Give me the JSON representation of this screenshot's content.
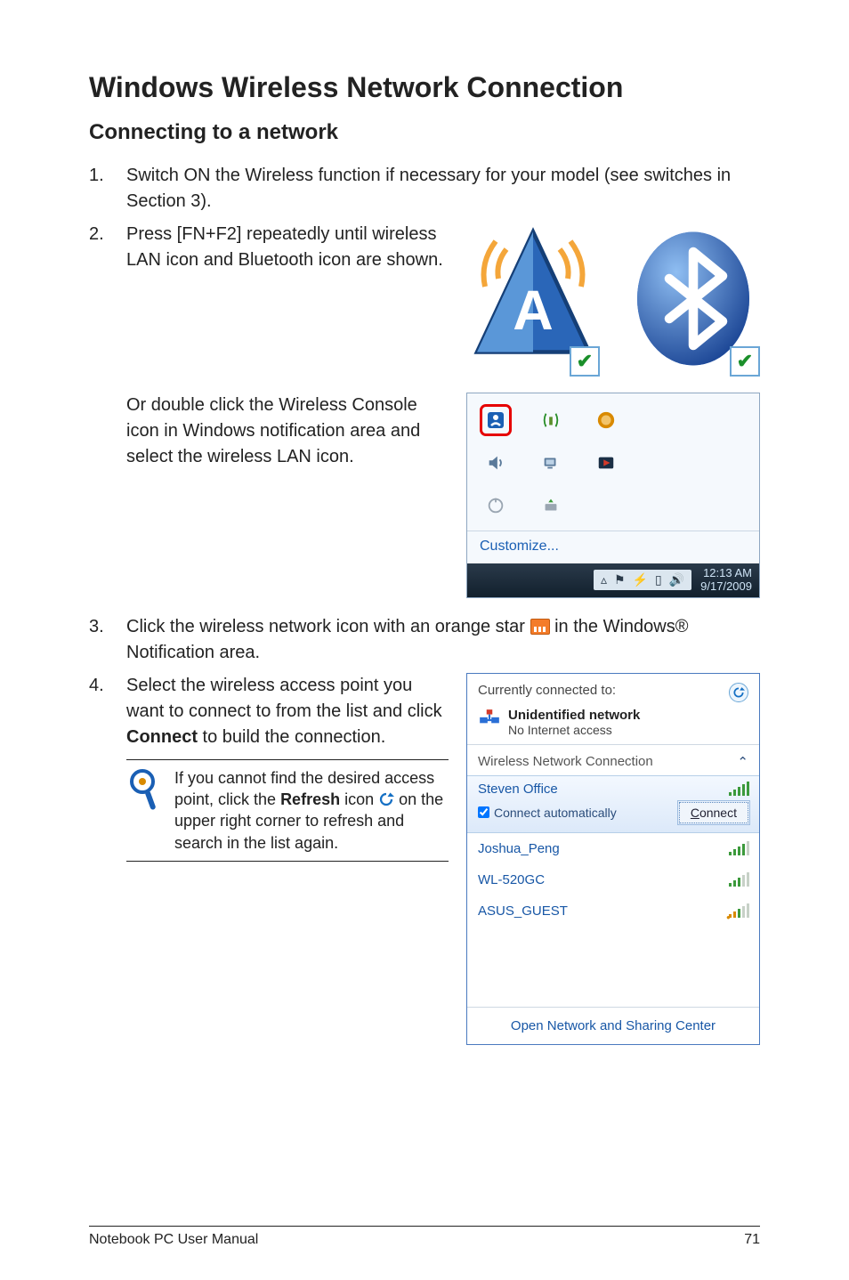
{
  "heading": "Windows Wireless Network Connection",
  "subheading": "Connecting to a network",
  "step1": {
    "num": "1.",
    "text": "Switch ON the Wireless function if necessary for your model (see switches in Section 3)."
  },
  "step2": {
    "num": "2.",
    "text": "Press [FN+F2] repeatedly until wireless LAN icon and Bluetooth icon are shown.",
    "extra": "Or double click the Wireless Console icon in Windows notification area and select the wireless LAN icon."
  },
  "tray": {
    "customize": "Customize...",
    "clock_time": "12:13 AM",
    "clock_date": "9/17/2009"
  },
  "step3": {
    "num": "3.",
    "pre": "Click the wireless network icon with an orange star ",
    "post": " in the Windows® Notification area."
  },
  "step4": {
    "num": "4.",
    "text_pre": "Select the wireless access point you want to connect to from the list and click ",
    "connect_bold": "Connect",
    "text_post": " to build the connection."
  },
  "note": {
    "pre": "If you cannot find the desired access point, click the ",
    "refresh_bold": "Refresh",
    "mid": " icon ",
    "post": " on the upper right corner to refresh and search in the list again."
  },
  "wifi": {
    "currently": "Currently connected to:",
    "net_name": "Unidentified network",
    "net_sub": "No Internet access",
    "section": "Wireless Network Connection",
    "selected": "Steven Office",
    "auto_label": "Connect automatically",
    "connect_btn": "Connect",
    "items": [
      "Joshua_Peng",
      "WL-520GC",
      "ASUS_GUEST"
    ],
    "footer": "Open Network and Sharing Center"
  },
  "footer": {
    "left": "Notebook PC User Manual",
    "right": "71"
  }
}
